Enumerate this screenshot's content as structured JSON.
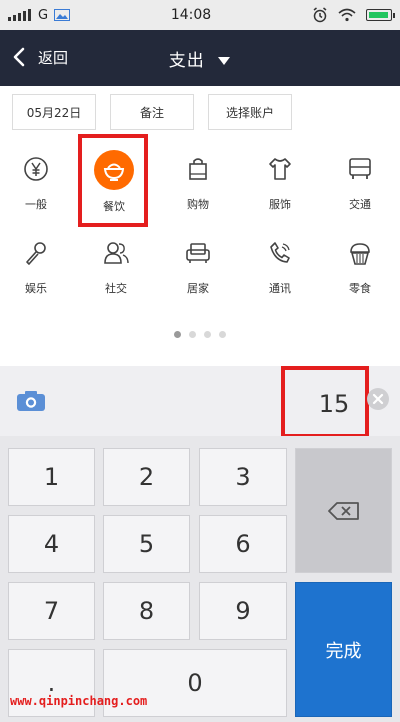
{
  "status_bar": {
    "carrier": "G",
    "time": "14:08"
  },
  "header": {
    "back_label": "返回",
    "title": "支出"
  },
  "filters": {
    "date": "05月22日",
    "note": "备注",
    "account": "选择账户"
  },
  "categories": [
    {
      "label": "一般",
      "icon": "yen-icon"
    },
    {
      "label": "餐饮",
      "icon": "food-bowl-icon",
      "selected": true
    },
    {
      "label": "购物",
      "icon": "shopping-bag-icon"
    },
    {
      "label": "服饰",
      "icon": "clothing-icon"
    },
    {
      "label": "交通",
      "icon": "bus-icon"
    },
    {
      "label": "娱乐",
      "icon": "microphone-icon"
    },
    {
      "label": "社交",
      "icon": "people-icon"
    },
    {
      "label": "居家",
      "icon": "sofa-icon"
    },
    {
      "label": "通讯",
      "icon": "phone-icon"
    },
    {
      "label": "零食",
      "icon": "cupcake-icon"
    }
  ],
  "pager": {
    "pages": 4,
    "active": 1
  },
  "amount": "15",
  "keypad": {
    "keys": [
      "1",
      "2",
      "3",
      "4",
      "5",
      "6",
      "7",
      "8",
      "9",
      ".",
      "0"
    ],
    "done_label": "完成"
  },
  "watermark": "www.qinpinchang.com",
  "colors": {
    "header_bg": "#23293a",
    "accent_orange": "#ff6a00",
    "done_blue": "#1e73cf",
    "highlight_red": "#e41e1e"
  }
}
